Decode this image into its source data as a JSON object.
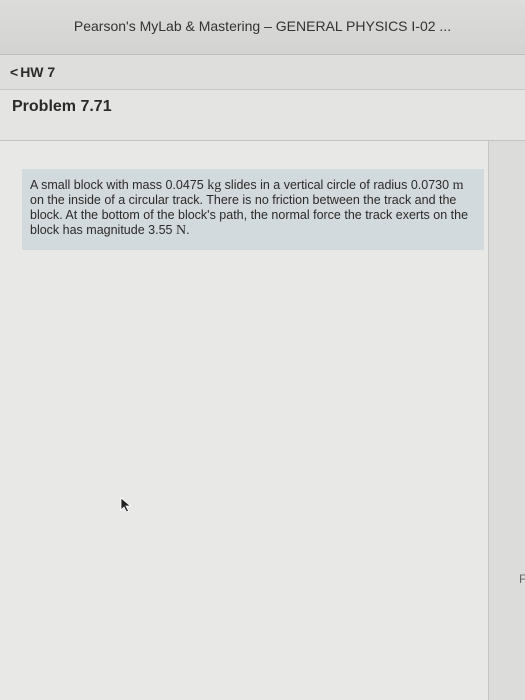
{
  "header": {
    "app_title": "Pearson's MyLab & Mastering – GENERAL PHYSICS I-02 ..."
  },
  "nav": {
    "back_chevron": "<",
    "back_label": "HW 7"
  },
  "problem": {
    "title": "Problem 7.71",
    "text": {
      "p1": "A small block with mass ",
      "mass_value": "0.0475",
      "mass_unit": "kg",
      "p2": " slides in a vertical circle of radius ",
      "radius_value": "0.0730",
      "radius_unit": "m",
      "p3": " on the inside of a circular track. There is no friction between the track and the block. At the bottom of the block's path, the normal force the track exerts on the block has magnitude ",
      "force_value": "3.55",
      "force_unit": "N",
      "p4": "."
    }
  },
  "edge": {
    "letter": "F"
  },
  "icons": {
    "cursor": "pointer-arrow-icon",
    "back": "chevron-left-icon"
  },
  "colors": {
    "problem_box_bg": "#d3dadd",
    "page_bg": "#e8e8e6"
  }
}
